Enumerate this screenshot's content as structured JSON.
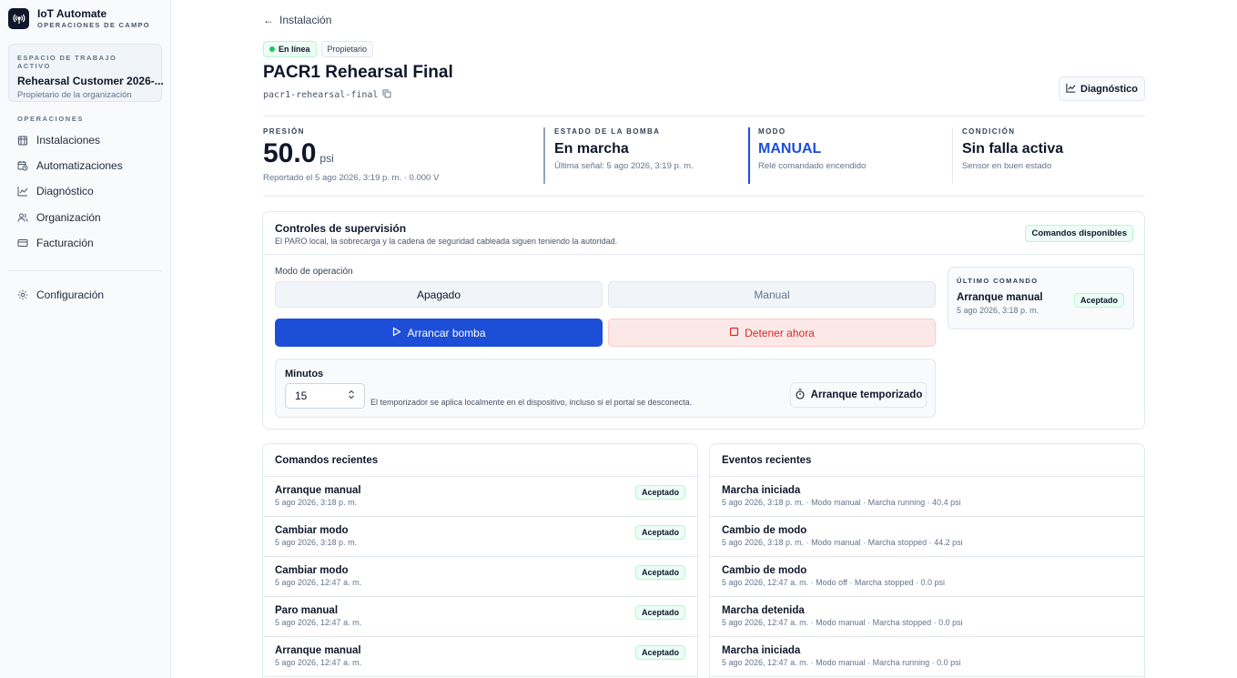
{
  "brand": {
    "title": "IoT Automate",
    "subtitle": "OPERACIONES DE CAMPO",
    "icon": "antenna-icon"
  },
  "workspace": {
    "kicker": "ESPACIO DE TRABAJO ACTIVO",
    "name": "Rehearsal Customer 2026-...",
    "role": "Propietario de la organización"
  },
  "nav": {
    "section": "OPERACIONES",
    "items": [
      {
        "label": "Instalaciones",
        "icon": "building-icon"
      },
      {
        "label": "Automatizaciones",
        "icon": "clock-calendar-icon"
      },
      {
        "label": "Diagnóstico",
        "icon": "chart-line-icon"
      },
      {
        "label": "Organización",
        "icon": "users-icon"
      },
      {
        "label": "Facturación",
        "icon": "credit-card-icon"
      }
    ],
    "settings": {
      "label": "Configuración",
      "icon": "gear-icon"
    }
  },
  "header": {
    "back_label": "Instalación",
    "status_badge": "En línea",
    "role_badge": "Propietario",
    "title": "PACR1 Rehearsal Final",
    "slug": "pacr1-rehearsal-final",
    "diagnostics_button": "Diagnóstico"
  },
  "stats": {
    "pressure": {
      "kicker": "PRESIÓN",
      "value": "50.0",
      "unit": "psi",
      "sub": "Reportado el 5 ago 2026, 3:19 p. m. · 0.000 V"
    },
    "pump": {
      "kicker": "ESTADO DE LA BOMBA",
      "value": "En marcha",
      "sub": "Última señal: 5 ago 2026, 3:19 p. m.",
      "color": "#0f172a"
    },
    "mode": {
      "kicker": "MODO",
      "value": "MANUAL",
      "sub": "Relé comandado encendido",
      "color": "#1d4ed8"
    },
    "condition": {
      "kicker": "CONDICIÓN",
      "value": "Sin falla activa",
      "sub": "Sensor en buen estado"
    }
  },
  "controls": {
    "title": "Controles de supervisión",
    "subtitle": "El PARO local, la sobrecarga y la cadena de seguridad cableada siguen teniendo la autoridad.",
    "available_badge": "Comandos disponibles",
    "mode_label": "Modo de operación",
    "mode_off": "Apagado",
    "mode_manual": "Manual",
    "start_button": "Arrancar bomba",
    "stop_button": "Detener ahora",
    "timer": {
      "label": "Minutos",
      "value": "15",
      "note": "El temporizador se aplica localmente en el dispositivo, incluso si el portal se desconecta.",
      "button": "Arranque temporizado"
    },
    "last_command": {
      "kicker": "ÚLTIMO COMANDO",
      "name": "Arranque manual",
      "status": "Aceptado",
      "time": "5 ago 2026, 3:18 p. m."
    }
  },
  "recent_commands": {
    "title": "Comandos recientes",
    "rows": [
      {
        "name": "Arranque manual",
        "time": "5 ago 2026, 3:18 p. m.",
        "status": "Aceptado"
      },
      {
        "name": "Cambiar modo",
        "time": "5 ago 2026, 3:18 p. m.",
        "status": "Aceptado"
      },
      {
        "name": "Cambiar modo",
        "time": "5 ago 2026, 12:47 a. m.",
        "status": "Aceptado"
      },
      {
        "name": "Paro manual",
        "time": "5 ago 2026, 12:47 a. m.",
        "status": "Aceptado"
      },
      {
        "name": "Arranque manual",
        "time": "5 ago 2026, 12:47 a. m.",
        "status": "Aceptado"
      }
    ]
  },
  "recent_events": {
    "title": "Eventos recientes",
    "rows": [
      {
        "name": "Marcha iniciada",
        "detail": "5 ago 2026, 3:18 p. m. · Modo manual · Marcha running · 40.4 psi"
      },
      {
        "name": "Cambio de modo",
        "detail": "5 ago 2026, 3:18 p. m. · Modo manual · Marcha stopped · 44.2 psi"
      },
      {
        "name": "Cambio de modo",
        "detail": "5 ago 2026, 12:47 a. m. · Modo off · Marcha stopped · 0.0 psi"
      },
      {
        "name": "Marcha detenida",
        "detail": "5 ago 2026, 12:47 a. m. · Modo manual · Marcha stopped · 0.0 psi"
      },
      {
        "name": "Marcha iniciada",
        "detail": "5 ago 2026, 12:47 a. m. · Modo manual · Marcha running · 0.0 psi"
      }
    ]
  }
}
